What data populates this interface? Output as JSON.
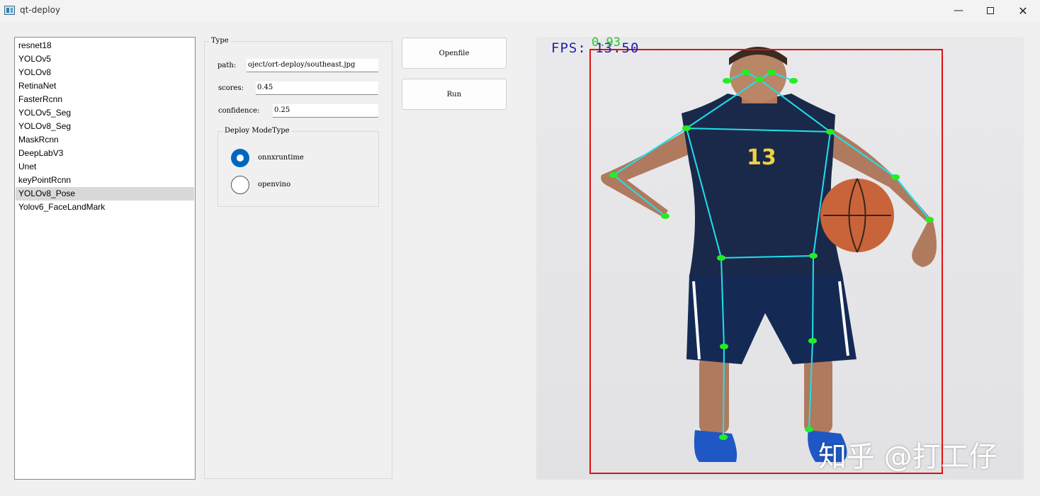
{
  "window": {
    "title": "qt-deploy",
    "minimize_icon": "minimize-icon",
    "maximize_icon": "maximize-icon",
    "close_icon": "close-icon"
  },
  "models": {
    "items": [
      "resnet18",
      "YOLOv5",
      "YOLOv8",
      "RetinaNet",
      "FasterRcnn",
      "YOLOv5_Seg",
      "YOLOv8_Seg",
      "MaskRcnn",
      "DeepLabV3",
      "Unet",
      "keyPointRcnn",
      "YOLOv8_Pose",
      "Yolov6_FaceLandMark"
    ],
    "selected": "YOLOv8_Pose"
  },
  "type_group": {
    "title": "Type",
    "path_label": "path:",
    "path_value": "oject/ort-deploy/southeast.jpg",
    "scores_label": "scores:",
    "scores_value": "0.45",
    "confidence_label": "confidence:",
    "confidence_value": "0.25"
  },
  "deploy_mode": {
    "title": "Deploy ModeType",
    "options": [
      "onnxruntime",
      "openvino"
    ],
    "selected": "onnxruntime"
  },
  "buttons": {
    "openfile": "Openfile",
    "run": "Run"
  },
  "result": {
    "fps_text": "FPS: 13.50",
    "score_text": "0.93",
    "jersey_number": "13",
    "watermark": "知乎 @打工仔",
    "colors": {
      "bbox": "#e01010",
      "skeleton": "#20e0ee",
      "keypoint": "#22ee22",
      "fps": "#1f1fa6"
    }
  }
}
